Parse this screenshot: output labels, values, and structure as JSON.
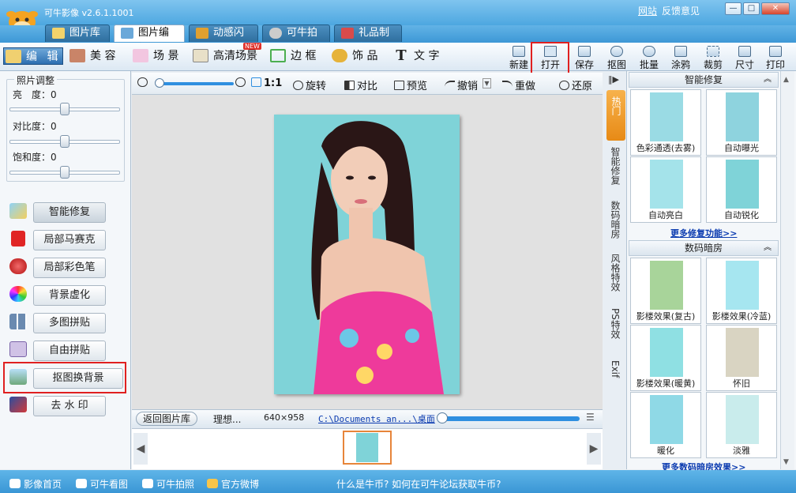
{
  "window": {
    "app_name": "可牛影像",
    "version": "v2.6.1.1001",
    "links": [
      "网站",
      "反馈意见"
    ],
    "controls": [
      "minimize",
      "maximize",
      "close"
    ]
  },
  "main_tabs": [
    {
      "label": "图片库",
      "active": false
    },
    {
      "label": "图片编辑",
      "active": true
    },
    {
      "label": "动感闪图",
      "active": false
    },
    {
      "label": "可牛拍照",
      "active": false
    },
    {
      "label": "礼品制作",
      "active": false
    }
  ],
  "mode_tabs": [
    "编 辑",
    "美 容",
    "场 景",
    "高清场景",
    "边 框",
    "饰 品",
    "文 字"
  ],
  "new_badge": "NEW",
  "toolbar": [
    "新建",
    "打开",
    "保存",
    "抠图",
    "批量",
    "涂鸦",
    "裁剪",
    "尺寸",
    "打印"
  ],
  "adjust": {
    "title": "照片调整",
    "items": [
      {
        "label": "亮　度：",
        "value": 0
      },
      {
        "label": "对比度：",
        "value": 0
      },
      {
        "label": "饱和度：",
        "value": 0
      }
    ]
  },
  "functions": [
    "智能修复",
    "局部马赛克",
    "局部彩色笔",
    "背景虚化",
    "多图拼贴",
    "自由拼贴",
    "抠图换背景",
    "去 水 印"
  ],
  "canvas_toolbar": {
    "ratio": "1:1",
    "rotate": "旋转",
    "compare": "对比",
    "preview": "预览",
    "undo": "撤销",
    "redo": "重做",
    "restore": "还原",
    "zoom_level": 0.0
  },
  "status": {
    "back": "返回图片库",
    "name": "理想...",
    "size": "640×958",
    "path": "C:\\Documents an...\\桌面",
    "progress": 0.0
  },
  "side_tabs": [
    "热门",
    "智能修复",
    "数码暗房",
    "风格特效",
    "PS特效",
    "Exif"
  ],
  "right_sections": [
    {
      "title": "智能修复",
      "items": [
        "色彩通透(去雾)",
        "自动曝光",
        "自动亮白",
        "自动锐化"
      ],
      "more": "更多修复功能>>"
    },
    {
      "title": "数码暗房",
      "items": [
        "影楼效果(复古)",
        "影楼效果(冷蓝)",
        "影楼效果(暖黄)",
        "怀旧",
        "暖化",
        "淡雅"
      ],
      "more": "更多数码暗房效果>>"
    }
  ],
  "footer": {
    "items": [
      "影像首页",
      "可牛看图",
      "可牛拍照",
      "官方微博"
    ],
    "notice": "什么是牛币? 如何在可牛论坛获取牛币?"
  },
  "colors": {
    "title_blue": "#4da7e0",
    "highlight_red": "#e02020",
    "hot_orange": "#e78a16",
    "photo_bg": "#7fd3d8"
  }
}
